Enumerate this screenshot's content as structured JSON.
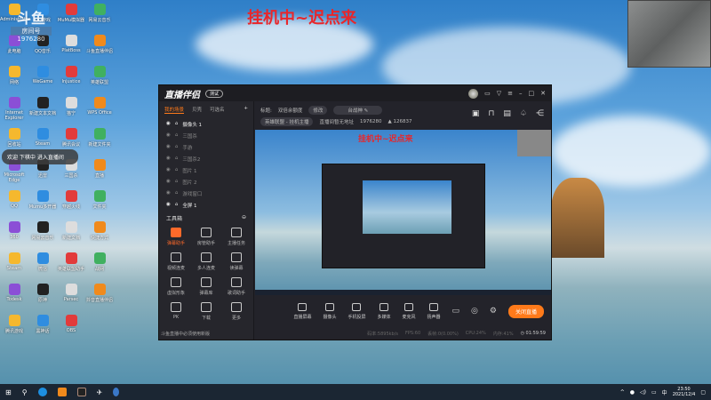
{
  "overlay_title": "挂机中~迟点来",
  "watermark": {
    "logo": "斗鱼",
    "room_label": "房间号",
    "room_id": "1976280"
  },
  "desktop_icons": [
    "Administrator",
    "QQ游戏",
    "MuMu模拟器",
    "网易云音乐",
    "此电脑",
    "QQ音乐",
    "PlatBoss",
    "斗鱼直播伴侣",
    "网络",
    "WeGame",
    "Injustice",
    "英雄联盟",
    "Internet Explorer",
    "新建文本文档",
    "猫宁",
    "WPS Office",
    "回收站",
    "Steam",
    "腾讯会议",
    "新建文件夹",
    "Microsoft Edge",
    "迅雷",
    "三国杀",
    "直播",
    "QQ",
    "Mumu多开器",
    "穿越火线",
    "文件夹",
    "360",
    "网易云音乐",
    "新建文档",
    "快捷方式",
    "Steam",
    "微信",
    "英雄联盟助手",
    "战网",
    "Todesk",
    "原神",
    "Parsec",
    "抖音直播伴侣",
    "腾讯游戏",
    "黑神话",
    "OBS"
  ],
  "toast": "欢迎 下棋中 进入直播间",
  "app": {
    "brand": "直播伴侣",
    "version": "测试",
    "left_tabs": [
      "我的场景",
      "贝壳",
      "可选名"
    ],
    "scenes": [
      {
        "name": "摄像头 1",
        "active": true
      },
      {
        "name": "三国杀"
      },
      {
        "name": "手游"
      },
      {
        "name": "三国杀2"
      },
      {
        "name": "图片 1"
      },
      {
        "name": "图片 2"
      },
      {
        "name": "游戏窗口"
      },
      {
        "name": "全屏 1",
        "active": true
      }
    ],
    "toolbox_label": "工具箱",
    "tools": [
      {
        "label": "弹幕助手",
        "hot": true
      },
      {
        "label": "房管助手"
      },
      {
        "label": "主播任务"
      },
      {
        "label": "视频连麦"
      },
      {
        "label": "多人连麦"
      },
      {
        "label": "读弹幕"
      },
      {
        "label": "虚拟形象"
      },
      {
        "label": "弹幕库"
      },
      {
        "label": "歌词助手"
      },
      {
        "label": "PK"
      },
      {
        "label": "下载"
      },
      {
        "label": "更多"
      }
    ],
    "tip": "斗鱼直播中必须使用新版",
    "header": {
      "title_label": "标题:",
      "title": "双倍余额度",
      "edit": "修改",
      "category_label": "分区:",
      "category": "台战神",
      "game": "英雄联盟 - 挂机主播",
      "notice": "直播间暂无地址",
      "room_id": "1976280",
      "followers": "126837"
    },
    "preview_title": "挂机中~迟点来",
    "bottom": [
      "直播屏幕",
      "摄像头",
      "手机投屏",
      "多媒体",
      "麦克风",
      "扬声器"
    ],
    "live_button": "关闭直播",
    "status": {
      "bitrate": "码率:5895kb/s",
      "fps": "FPS:60",
      "drop": "丢帧:0(0.00%)",
      "cpu": "CPU:24%",
      "mem": "内存:41%",
      "duration": "01:59:59"
    }
  },
  "taskbar": {
    "time": "23:50",
    "date": "2021/12/4"
  }
}
